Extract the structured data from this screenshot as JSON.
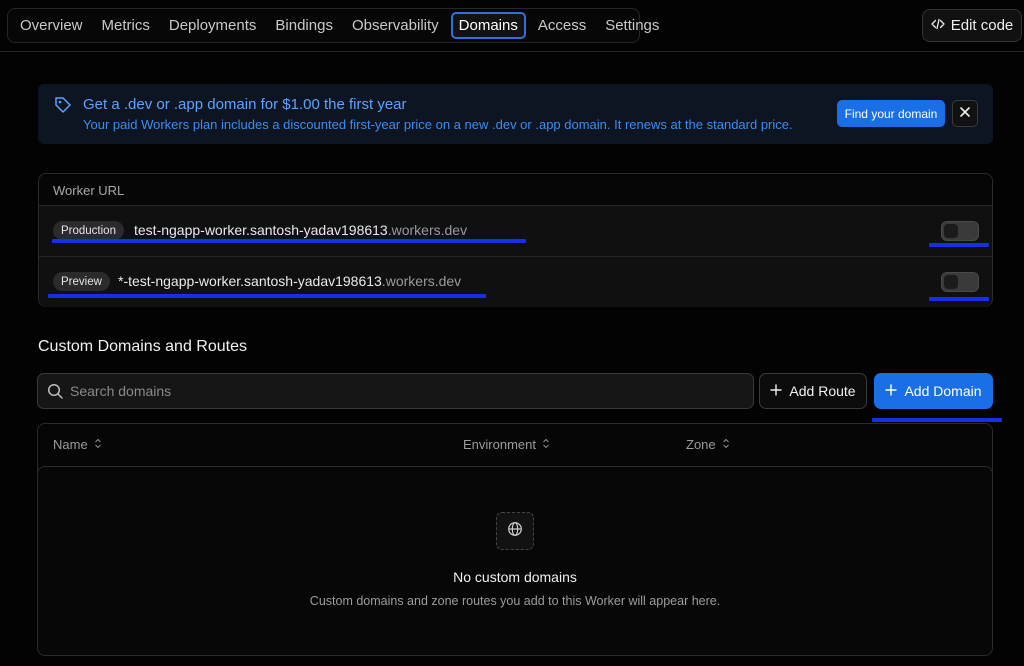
{
  "nav": {
    "tabs": [
      {
        "label": "Overview"
      },
      {
        "label": "Metrics"
      },
      {
        "label": "Deployments"
      },
      {
        "label": "Bindings"
      },
      {
        "label": "Observability"
      },
      {
        "label": "Domains",
        "active": true
      },
      {
        "label": "Access"
      },
      {
        "label": "Settings"
      }
    ],
    "edit_code_label": "Edit code"
  },
  "banner": {
    "title": "Get a .dev or .app domain for $1.00 the first year",
    "subtitle": "Your paid Workers plan includes a discounted first-year price on a new .dev or .app domain. It renews at the standard price.",
    "cta_label": "Find your domain"
  },
  "worker_url": {
    "title": "Worker URL",
    "rows": [
      {
        "env": "Production",
        "host": "test-ngapp-worker.santosh-yadav198613",
        "suffix": ".workers.dev",
        "enabled": false
      },
      {
        "env": "Preview",
        "host": "*-test-ngapp-worker.santosh-yadav198613",
        "suffix": ".workers.dev",
        "enabled": false
      }
    ]
  },
  "custom_domains": {
    "title": "Custom Domains and Routes",
    "search_placeholder": "Search domains",
    "add_route_label": "Add Route",
    "add_domain_label": "Add Domain",
    "columns": [
      "Name",
      "Environment",
      "Zone"
    ],
    "empty_title": "No custom domains",
    "empty_subtitle": "Custom domains and zone routes you add to this Worker will appear here."
  },
  "colors": {
    "accent": "#1a6fe6",
    "annotation_underline": "#1530e8",
    "banner_text": "#5ea2ff"
  }
}
